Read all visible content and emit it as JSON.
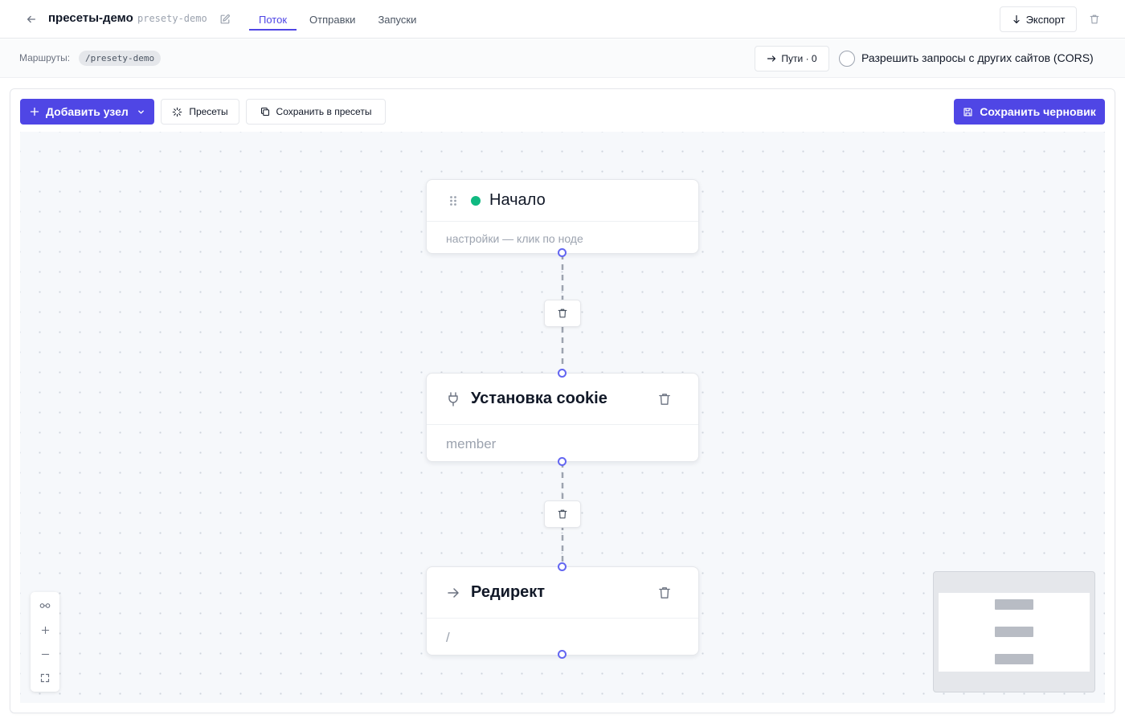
{
  "header": {
    "title": "пресеты-демо",
    "slug": "presety-demo",
    "tabs": [
      {
        "label": "Поток",
        "active": true
      },
      {
        "label": "Отправки",
        "active": false
      },
      {
        "label": "Запуски",
        "active": false
      }
    ],
    "export_label": "Экспорт"
  },
  "routes": {
    "label": "Маршруты:",
    "chip": "/presety-demo",
    "paths_label": "Пути · 0",
    "cors_label": "Разрешить запросы с других сайтов (CORS)",
    "cors_checked": false
  },
  "toolbar": {
    "add_node_label": "Добавить узел",
    "presets_label": "Пресеты",
    "save_presets_label": "Сохранить в пресеты",
    "save_draft_label": "Сохранить черновик"
  },
  "nodes": [
    {
      "title": "Начало",
      "subtitle": "настройки — клик по ноде",
      "status_color": "#10b981"
    },
    {
      "title": "Установка cookie",
      "subtitle": "member"
    },
    {
      "title": "Редирект",
      "subtitle": "/"
    }
  ],
  "colors": {
    "accent": "#4f46e5",
    "handle": "#6366f1",
    "status_active": "#10b981"
  },
  "icons": {
    "back": "arrow-left-icon",
    "edit": "pencil-square-icon",
    "export": "arrow-down-icon",
    "delete": "trash-icon",
    "paths": "arrow-right-icon",
    "add": "plus-icon",
    "chevron": "chevron-down-icon",
    "presets": "sparkle-loader-icon",
    "copy": "copy-icon",
    "save": "floppy-disk-icon",
    "drag": "drag-grip-icon",
    "plug": "plug-icon",
    "redirect": "arrow-right-icon",
    "minimap_toggle": "glasses-icon",
    "zoom_in": "plus-icon",
    "zoom_out": "minus-icon",
    "fit_view": "fullscreen-icon"
  }
}
